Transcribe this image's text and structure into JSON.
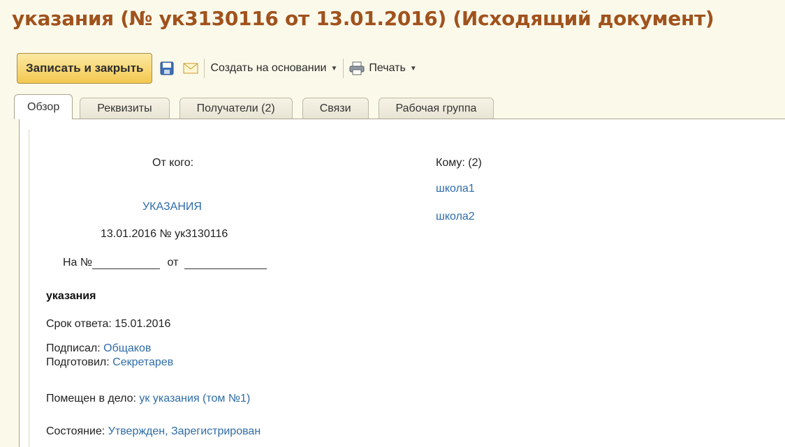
{
  "window": {
    "title": "указания (№ ук3130116 от 13.01.2016) (Исходящий документ)"
  },
  "toolbar": {
    "save_close_label": "Записать и закрыть",
    "create_based_label": "Создать на основании",
    "print_label": "Печать"
  },
  "tabs": [
    {
      "label": "Обзор",
      "active": true
    },
    {
      "label": "Реквизиты",
      "active": false
    },
    {
      "label": "Получатели (2)",
      "active": false
    },
    {
      "label": "Связи",
      "active": false
    },
    {
      "label": "Рабочая группа",
      "active": false
    }
  ],
  "overview": {
    "from_label": "От кого:",
    "to_label": "Кому: (2)",
    "recipients": [
      "школа1",
      "школа2"
    ],
    "doc_type": "УКАЗАНИЯ",
    "date_number": "13.01.2016 № ук3130116",
    "reply_no_label": "На №",
    "reply_from_label": "от",
    "subject": "указания",
    "due_label": "Срок ответа: 15.01.2016",
    "signed_label": "Подписал:",
    "signed_value": "Общаков",
    "prepared_label": "Подготовил:",
    "prepared_value": "Секретарев",
    "filed_label": "Помещен в дело:",
    "filed_value": "ук указания (том №1)",
    "state_label": "Состояние:",
    "state_value": "Утвержден, Зарегистрирован"
  },
  "colors": {
    "title": "#a0521d",
    "link": "#2e6ca8",
    "background": "#fbf9ea",
    "primary_button": "#f3c84f"
  }
}
